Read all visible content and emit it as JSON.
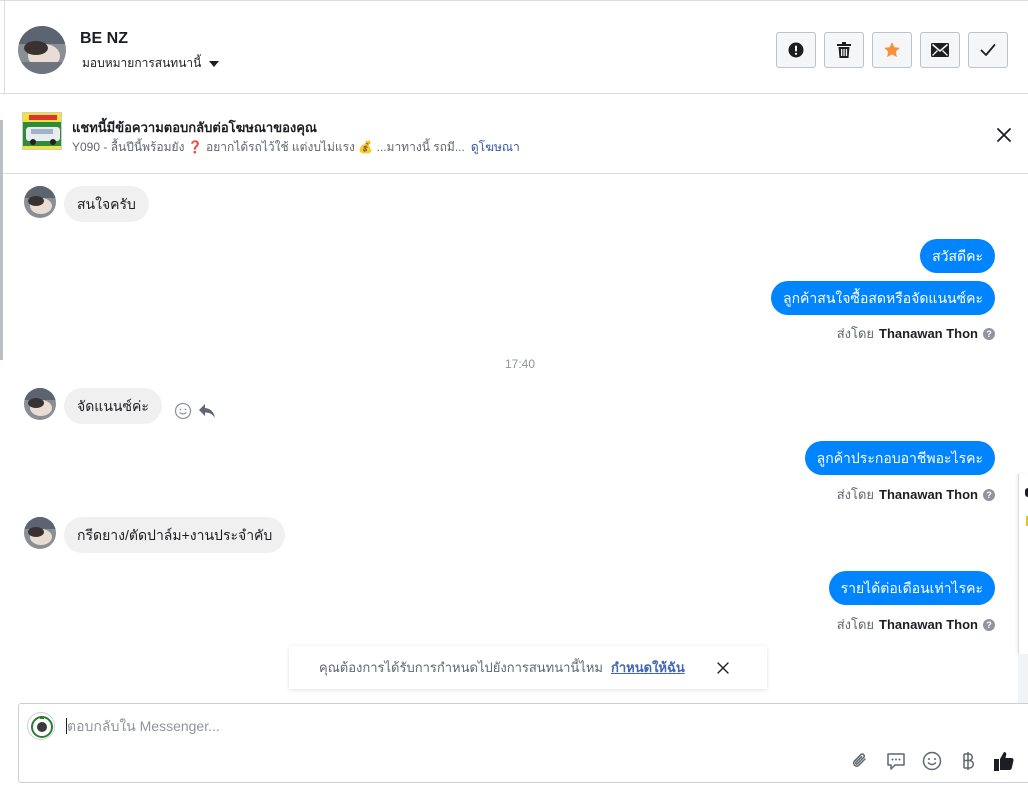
{
  "header": {
    "contact_name": "BE NZ",
    "assign_label": "มอบหมายการสนทนานี้",
    "actions": [
      {
        "name": "mark-spam-button",
        "icon": "exclamation-circle-icon"
      },
      {
        "name": "delete-button",
        "icon": "trash-icon"
      },
      {
        "name": "star-button",
        "icon": "star-icon",
        "color": "#f7923b"
      },
      {
        "name": "mark-unread-button",
        "icon": "envelope-icon"
      },
      {
        "name": "mark-done-button",
        "icon": "check-icon"
      }
    ]
  },
  "ad_banner": {
    "title": "แชทนี้มีข้อความตอบกลับต่อโฆษณาของคุณ",
    "subtitle_text": "Y090 - ลื้นปีนี้พร้อมยัง ❓ อยากได้รถไว้ใช้ แต่งบไม่แรง 💰 ...มาทางนี้ รถมี...",
    "link_label": "ดูโฆษณา"
  },
  "messages": {
    "in_1": "สนใจครับ",
    "out_1": "สวัสดีคะ",
    "out_2": "ลูกค้าสนใจซื้อสดหรือจัดแนนซ์คะ",
    "time_sep": "17:40",
    "in_2": "จัดแนนซ์ค่ะ",
    "out_3": "ลูกค้าประกอบอาชีพอะไรคะ",
    "in_3": "กรีดยาง/ตัดปาล์ม+งานประจำคับ",
    "out_4": "รายได้ต่อเดือนเท่าไรคะ"
  },
  "sent_by": {
    "prefix": "ส่งโดย",
    "agent": "Thanawan Thon",
    "help_glyph": "?"
  },
  "notice": {
    "text": "คุณต้องการได้รับการกำหนดไปยังการสนทนานี้ไหม",
    "link": "กำหนดให้ฉัน"
  },
  "composer": {
    "placeholder": "ตอบกลับใน Messenger...",
    "tools": [
      "paperclip-icon",
      "saved-reply-icon",
      "emoji-icon",
      "baht-icon",
      "thumbs-up-icon"
    ]
  },
  "colors": {
    "outgoing_bubble": "#0084ff",
    "incoming_bubble": "#f1f0f0",
    "link": "#365899",
    "star": "#f7923b"
  }
}
